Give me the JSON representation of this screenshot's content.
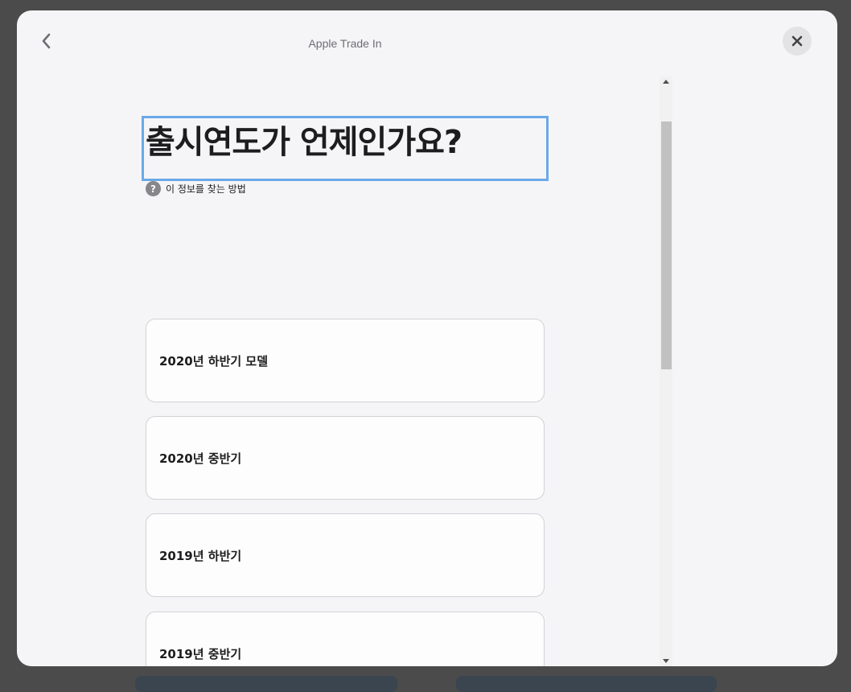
{
  "modal": {
    "title": "Apple Trade In"
  },
  "question": {
    "heading": "출시연도가 언제인가요?",
    "help_icon_glyph": "?",
    "help_text": "이 정보를 찾는 방법"
  },
  "options": [
    {
      "label": "2020년 하반기 모델"
    },
    {
      "label": "2020년 중반기"
    },
    {
      "label": "2019년 하반기"
    },
    {
      "label": "2019년 중반기"
    }
  ],
  "icons": {
    "back": "chevron-left-icon",
    "close": "close-icon",
    "help": "question-mark-icon"
  }
}
